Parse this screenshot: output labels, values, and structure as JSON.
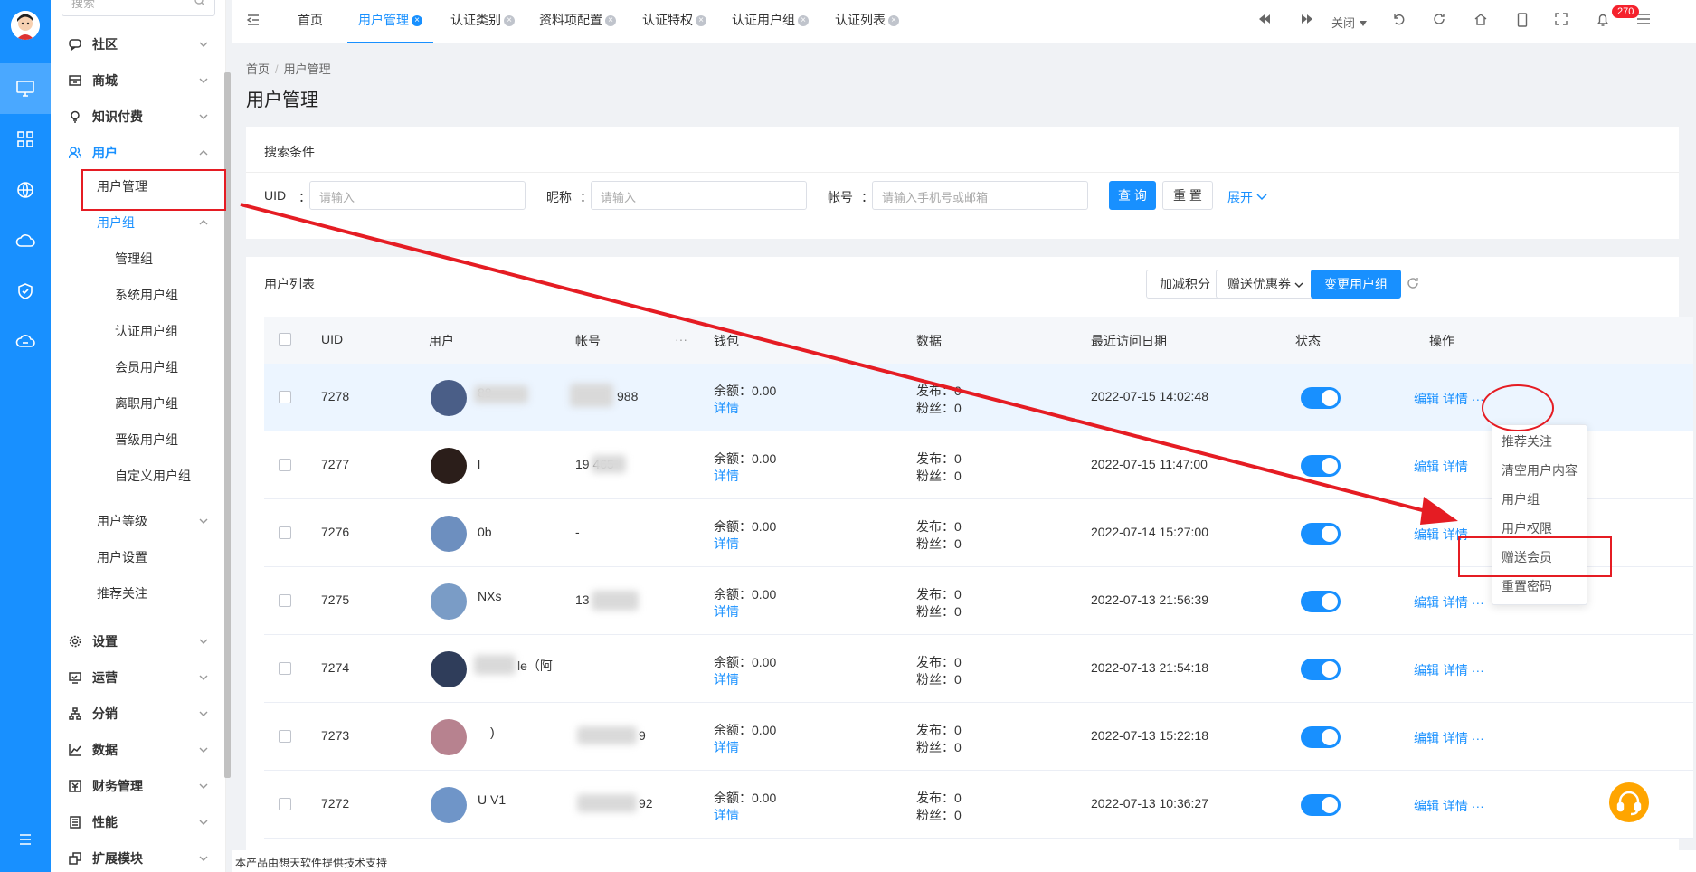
{
  "sidebar": {
    "search_placeholder": "搜索",
    "groups": [
      {
        "label": "社区",
        "icon": "chat-icon"
      },
      {
        "label": "商城",
        "icon": "shop-icon"
      },
      {
        "label": "知识付费",
        "icon": "bulb-icon"
      },
      {
        "label": "用户",
        "icon": "users-icon"
      },
      {
        "label": "设置",
        "icon": "gear-icon"
      },
      {
        "label": "运营",
        "icon": "monitor-icon"
      },
      {
        "label": "分销",
        "icon": "network-icon"
      },
      {
        "label": "数据",
        "icon": "chart-icon"
      },
      {
        "label": "财务管理",
        "icon": "finance-icon"
      },
      {
        "label": "性能",
        "icon": "performance-icon"
      },
      {
        "label": "扩展模块",
        "icon": "extension-icon"
      }
    ],
    "user_items": {
      "user_manage": "用户管理",
      "user_group": "用户组",
      "user_level": "用户等级",
      "user_settings": "用户设置",
      "recommend_follow": "推荐关注"
    },
    "group_items": [
      "管理组",
      "系统用户组",
      "认证用户组",
      "会员用户组",
      "离职用户组",
      "晋级用户组",
      "自定义用户组"
    ]
  },
  "topbar": {
    "tabs": [
      "首页",
      "用户管理",
      "认证类别",
      "资料项配置",
      "认证特权",
      "认证用户组",
      "认证列表"
    ],
    "close_label": "关闭",
    "notification_count": "270"
  },
  "breadcrumb": {
    "home": "首页",
    "current": "用户管理"
  },
  "page_title": "用户管理",
  "search": {
    "title": "搜索条件",
    "uid_label": "UID",
    "nickname_label": "昵称",
    "account_label": "帐号",
    "colon": "：",
    "uid_placeholder": "请输入",
    "nickname_placeholder": "请输入",
    "account_placeholder": "请输入手机号或邮箱",
    "query_button": "查 询",
    "reset_button": "重 置",
    "expand_link": "展开"
  },
  "list": {
    "title": "用户列表",
    "points_button": "加减积分",
    "coupon_button": "赠送优惠券",
    "change_group_button": "变更用户组",
    "columns": [
      "UID",
      "用户",
      "帐号",
      "钱包",
      "数据",
      "最近访问日期",
      "状态",
      "操作"
    ],
    "balance_label": "余额：0.00",
    "details_link": "详情",
    "edit_link": "编辑",
    "more": "···",
    "rows": [
      {
        "uid": "7278",
        "user": "88",
        "account": "988",
        "publish": "发布：0",
        "fans": "粉丝：0",
        "date": "2022-07-15 14:02:48"
      },
      {
        "uid": "7277",
        "user": "l",
        "account": "19 465",
        "publish": "发布：0",
        "fans": "粉丝：0",
        "date": "2022-07-15 11:47:00"
      },
      {
        "uid": "7276",
        "user": "0b",
        "account": "-",
        "publish": "发布：0",
        "fans": "粉丝：0",
        "date": "2022-07-14 15:27:00"
      },
      {
        "uid": "7275",
        "user": "NXs",
        "account": "13",
        "publish": "发布：0",
        "fans": "粉丝：0",
        "date": "2022-07-13 21:56:39"
      },
      {
        "uid": "7274",
        "user": "le（阿",
        "account": "",
        "publish": "发布：0",
        "fans": "粉丝：0",
        "date": "2022-07-13 21:54:18"
      },
      {
        "uid": "7273",
        "user": ")",
        "account": "9",
        "publish": "发布：0",
        "fans": "粉丝：0",
        "date": "2022-07-13 15:22:18"
      },
      {
        "uid": "7272",
        "user": "U V1",
        "account": "92",
        "publish": "发布：0",
        "fans": "粉丝：0",
        "date": "2022-07-13 10:36:27"
      }
    ]
  },
  "dropdown": [
    "推荐关注",
    "清空用户内容",
    "用户组",
    "用户权限",
    "赠送会员",
    "重置密码"
  ],
  "footer": "本产品由想天软件提供技术支持",
  "colors": {
    "primary": "#1890ff",
    "annotation": "#e51c23",
    "support": "#ffa500"
  }
}
